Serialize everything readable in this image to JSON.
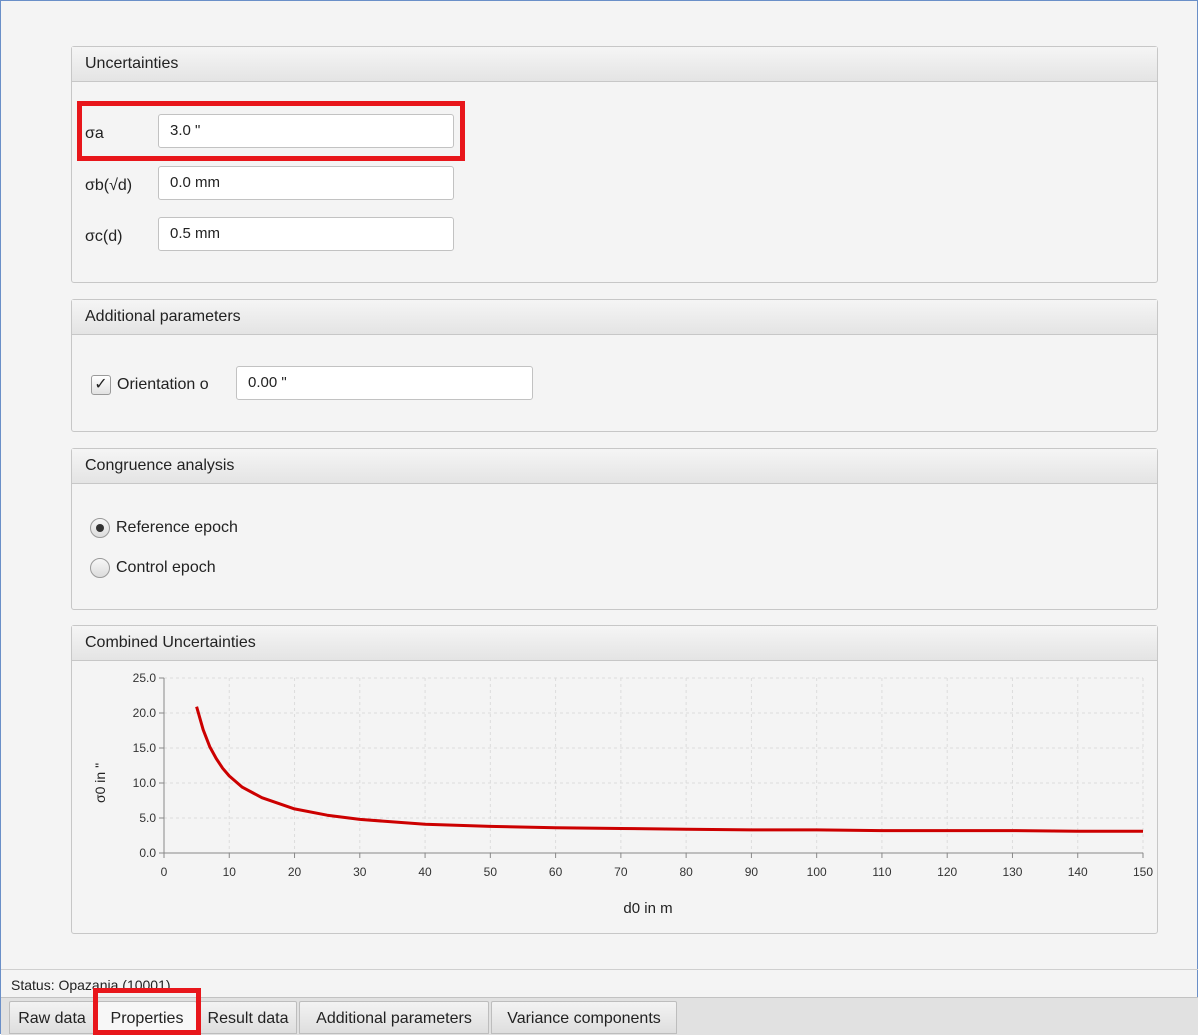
{
  "uncertainties": {
    "header": "Uncertainties",
    "rows": [
      {
        "label": "σa",
        "value": "3.0 \""
      },
      {
        "label": "σb(√d)",
        "value": "0.0 mm"
      },
      {
        "label": "σc(d)",
        "value": "0.5 mm"
      }
    ]
  },
  "additional_parameters": {
    "header": "Additional parameters",
    "orientation": {
      "label": "Orientation o",
      "checked": true,
      "value": "0.00 \""
    }
  },
  "congruence_analysis": {
    "header": "Congruence analysis",
    "options": [
      {
        "label": "Reference epoch",
        "selected": true
      },
      {
        "label": "Control epoch",
        "selected": false
      }
    ]
  },
  "combined_uncertainties": {
    "header": "Combined Uncertainties"
  },
  "chart_data": {
    "type": "line",
    "xlabel": "d0 in m",
    "ylabel": "σ0 in \"",
    "xlim": [
      0,
      150
    ],
    "ylim": [
      0,
      25
    ],
    "xticks": [
      0,
      10,
      20,
      30,
      40,
      50,
      60,
      70,
      80,
      90,
      100,
      110,
      120,
      130,
      140,
      150
    ],
    "yticks": [
      "0.0",
      "5.0",
      "10.0",
      "15.0",
      "20.0",
      "25.0"
    ],
    "grid": true,
    "series": [
      {
        "color": "#cc0000",
        "x": [
          5,
          6,
          7,
          8,
          9,
          10,
          12,
          15,
          20,
          25,
          30,
          40,
          50,
          60,
          70,
          80,
          90,
          100,
          110,
          120,
          130,
          140,
          150
        ],
        "y": [
          20.9,
          17.6,
          15.2,
          13.5,
          12.1,
          11.0,
          9.4,
          7.9,
          6.3,
          5.4,
          4.8,
          4.1,
          3.8,
          3.6,
          3.5,
          3.4,
          3.3,
          3.3,
          3.2,
          3.2,
          3.2,
          3.1,
          3.1
        ]
      }
    ]
  },
  "status": {
    "text": "Status: Opazania (10001)"
  },
  "tabs": [
    {
      "label": "Raw data",
      "selected": false
    },
    {
      "label": "Properties",
      "selected": true
    },
    {
      "label": "Result data",
      "selected": false
    },
    {
      "label": "Additional parameters",
      "selected": false
    },
    {
      "label": "Variance components",
      "selected": false
    }
  ],
  "colors": {
    "highlight": "#e8161b",
    "curve": "#cc0000"
  }
}
